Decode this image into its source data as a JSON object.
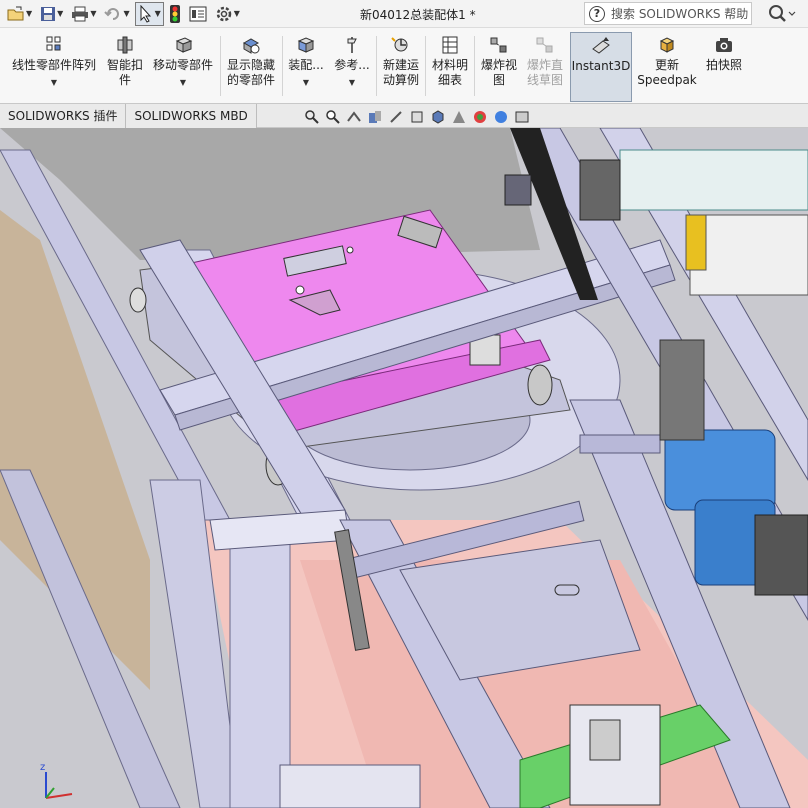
{
  "window": {
    "title": "新04012总装配体1 *",
    "help_search_placeholder": "搜索 SOLIDWORKS 帮助"
  },
  "quick_access": [
    {
      "name": "open-icon"
    },
    {
      "name": "save-icon"
    },
    {
      "name": "print-icon"
    },
    {
      "name": "undo-icon"
    },
    {
      "name": "select-icon"
    },
    {
      "name": "traffic-light-icon"
    },
    {
      "name": "file-properties-icon"
    },
    {
      "name": "options-gear-icon"
    }
  ],
  "ribbon": {
    "buttons": [
      {
        "label": "线性零部件阵列",
        "icon": "linear-pattern-icon"
      },
      {
        "label": "智能扣\n件",
        "icon": "smart-fastener-icon"
      },
      {
        "label": "移动零部件",
        "icon": "move-component-icon"
      },
      {
        "label": "显示隐藏\n的零部件",
        "icon": "show-hidden-icon"
      },
      {
        "label": "装配...",
        "icon": "assembly-features-icon"
      },
      {
        "label": "参考...",
        "icon": "reference-geometry-icon"
      },
      {
        "label": "新建运\n动算例",
        "icon": "new-motion-study-icon"
      },
      {
        "label": "材料明\n细表",
        "icon": "bill-of-materials-icon"
      },
      {
        "label": "爆炸视\n图",
        "icon": "exploded-view-icon"
      },
      {
        "label": "爆炸直\n线草图",
        "icon": "explode-line-sketch-icon"
      },
      {
        "label": "Instant3D",
        "icon": "instant3d-icon"
      },
      {
        "label": "更新\nSpeedpak",
        "icon": "update-speedpak-icon"
      },
      {
        "label": "拍快照",
        "icon": "take-snapshot-icon"
      }
    ]
  },
  "tabs": [
    {
      "label": "SOLIDWORKS 插件"
    },
    {
      "label": "SOLIDWORKS MBD"
    }
  ],
  "triad": {
    "z_label": "z"
  },
  "colors": {
    "ribbon_bg": "#f7f7f7",
    "frame": "#c8c8e4",
    "magenta_plate": "#ee88ee",
    "floor": "#f4c6c0",
    "motor": "#4a8fdc",
    "rail_green": "#68d068"
  }
}
